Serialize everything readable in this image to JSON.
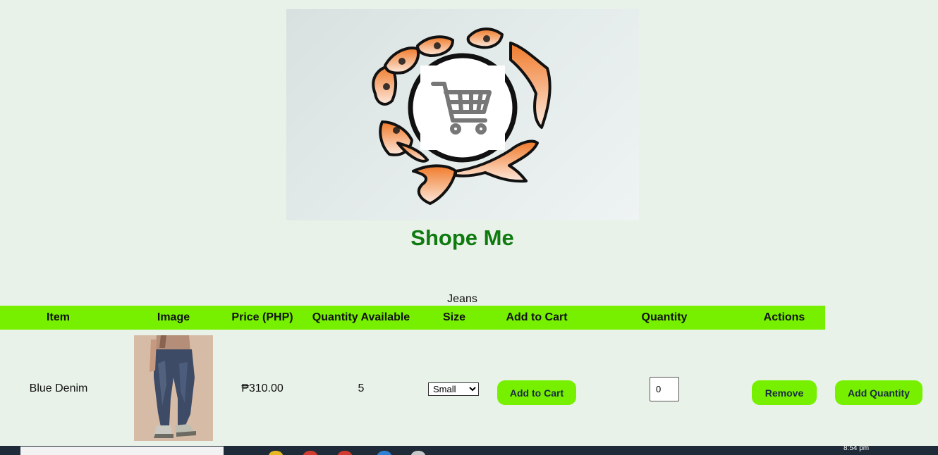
{
  "header": {
    "banner_alt": "Shope Me logo with shopping cart",
    "title": "Shope Me"
  },
  "category": {
    "name": "Jeans"
  },
  "table": {
    "columns": [
      "Item",
      "Image",
      "Price (PHP)",
      "Quantity Available",
      "Size",
      "Add to Cart",
      "Quantity",
      "Actions"
    ],
    "rows": [
      {
        "item": "Blue Denim",
        "price": "₱310.00",
        "quantity_available": "5",
        "size_selected": "Small",
        "add_to_cart_label": "Add to Cart",
        "quantity_value": "0",
        "remove_label": "Remove",
        "add_quantity_label": "Add Quantity"
      }
    ]
  },
  "taskbar": {
    "clock": "8:54 pm"
  },
  "colors": {
    "background": "#e8f2e8",
    "accent": "#77f000",
    "title": "#0f7a0f",
    "banner_letters": "#f07a2a"
  }
}
